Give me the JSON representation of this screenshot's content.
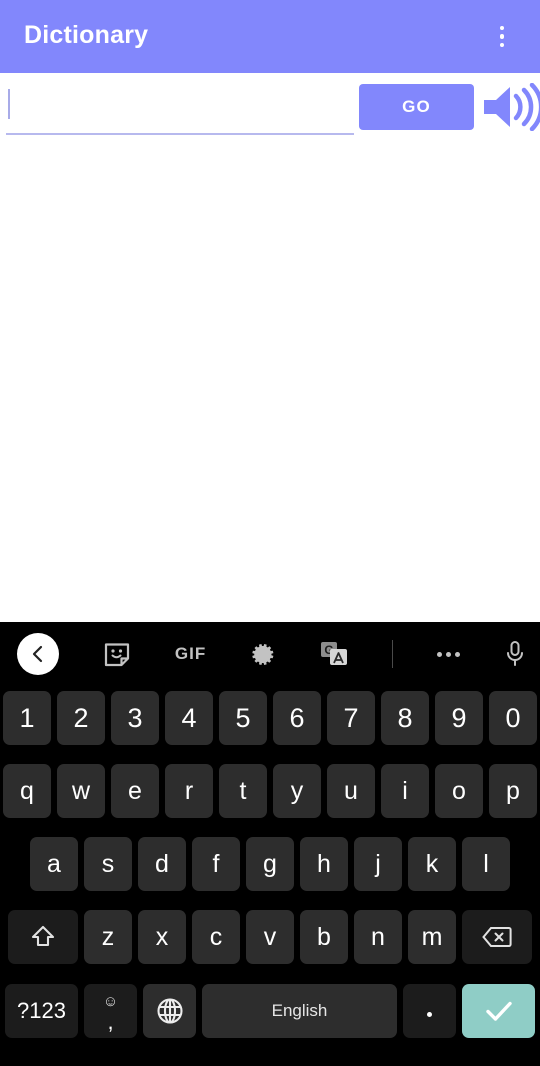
{
  "appbar": {
    "title": "Dictionary",
    "overflow_menu_name": "more-options",
    "background_color": "#8287fc",
    "title_color": "#ffffff"
  },
  "search": {
    "input_value": "",
    "placeholder": "",
    "go_label": "GO",
    "go_color": "#8287fc",
    "speaker_icon": "volume-up-icon",
    "underline_color": "#b7b9ee"
  },
  "content": {
    "text": ""
  },
  "keyboard": {
    "background_color": "#000000",
    "key_color": "#2d2d2d",
    "mod_key_color": "#1c1c1c",
    "enter_key_color": "#8fcdc6",
    "toolbar": [
      {
        "name": "back-arrow-icon",
        "label": ""
      },
      {
        "name": "sticker-icon",
        "label": ""
      },
      {
        "name": "gif-icon",
        "label": "GIF"
      },
      {
        "name": "gear-icon",
        "label": ""
      },
      {
        "name": "google-translate-icon",
        "label": ""
      },
      {
        "name": "toolbar-divider",
        "label": ""
      },
      {
        "name": "more-horizontal-icon",
        "label": ""
      },
      {
        "name": "microphone-icon",
        "label": ""
      }
    ],
    "rows": {
      "numbers": [
        "1",
        "2",
        "3",
        "4",
        "5",
        "6",
        "7",
        "8",
        "9",
        "0"
      ],
      "top": [
        "q",
        "w",
        "e",
        "r",
        "t",
        "y",
        "u",
        "i",
        "o",
        "p"
      ],
      "home": [
        "a",
        "s",
        "d",
        "f",
        "g",
        "h",
        "j",
        "k",
        "l"
      ],
      "bottom": [
        "z",
        "x",
        "c",
        "v",
        "b",
        "n",
        "m"
      ]
    },
    "shift_key": {
      "name": "shift-key",
      "icon": "shift-arrow-icon"
    },
    "backspace_key": {
      "name": "backspace-key",
      "icon": "backspace-icon"
    },
    "symbols_key": {
      "label": "?123"
    },
    "emoji_comma_key": {
      "emoji": "☺",
      "comma": ","
    },
    "globe_key": {
      "icon": "globe-icon"
    },
    "space_key": {
      "label": "English"
    },
    "period_key": {
      "label": "."
    },
    "enter_key": {
      "icon": "checkmark-icon"
    }
  }
}
